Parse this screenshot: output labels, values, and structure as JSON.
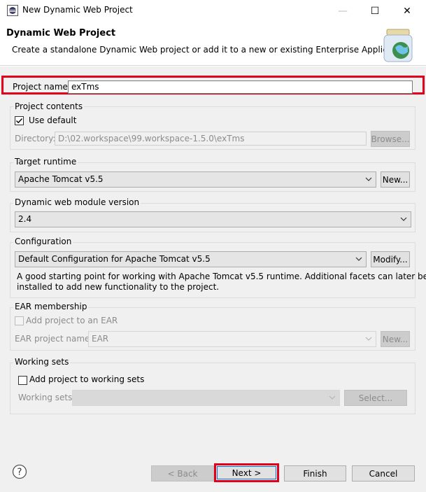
{
  "window": {
    "title": "New Dynamic Web Project",
    "minimize_glyph": "—",
    "maximize_glyph": "☐",
    "close_glyph": "✕"
  },
  "header": {
    "title": "Dynamic Web Project",
    "description": "Create a standalone Dynamic Web project or add it to a new or existing Enterprise Application."
  },
  "project_name": {
    "label": "Project name:",
    "value": "exTms"
  },
  "project_contents": {
    "group_title": "Project contents",
    "use_default_label": "Use default",
    "use_default_checked": true,
    "directory_label": "Directory:",
    "directory_value": "D:\\02.workspace\\99.workspace-1.5.0\\exTms",
    "browse_label": "Browse..."
  },
  "target_runtime": {
    "group_title": "Target runtime",
    "selected": "Apache Tomcat v5.5",
    "new_label": "New..."
  },
  "module_version": {
    "group_title": "Dynamic web module version",
    "selected": "2.4"
  },
  "configuration": {
    "group_title": "Configuration",
    "selected": "Default Configuration for Apache Tomcat v5.5",
    "modify_label": "Modify...",
    "description_line1": "A good starting point for working with Apache Tomcat v5.5 runtime. Additional facets can later be",
    "description_line2": "installed to add new functionality to the project."
  },
  "ear_membership": {
    "group_title": "EAR membership",
    "add_label": "Add project to an EAR",
    "add_checked": false,
    "ear_project_label": "EAR project name:",
    "ear_project_value": "EAR",
    "new_label": "New..."
  },
  "working_sets": {
    "group_title": "Working sets",
    "add_label": "Add project to working sets",
    "add_checked": false,
    "working_sets_label": "Working sets:",
    "working_sets_value": "",
    "select_label": "Select..."
  },
  "footer": {
    "help_glyph": "?",
    "back_label": "< Back",
    "next_label": "Next >",
    "finish_label": "Finish",
    "cancel_label": "Cancel"
  },
  "colors": {
    "highlight": "#e0001b",
    "dialog_bg": "#f0f0f0",
    "focus_blue": "#0078d7"
  }
}
